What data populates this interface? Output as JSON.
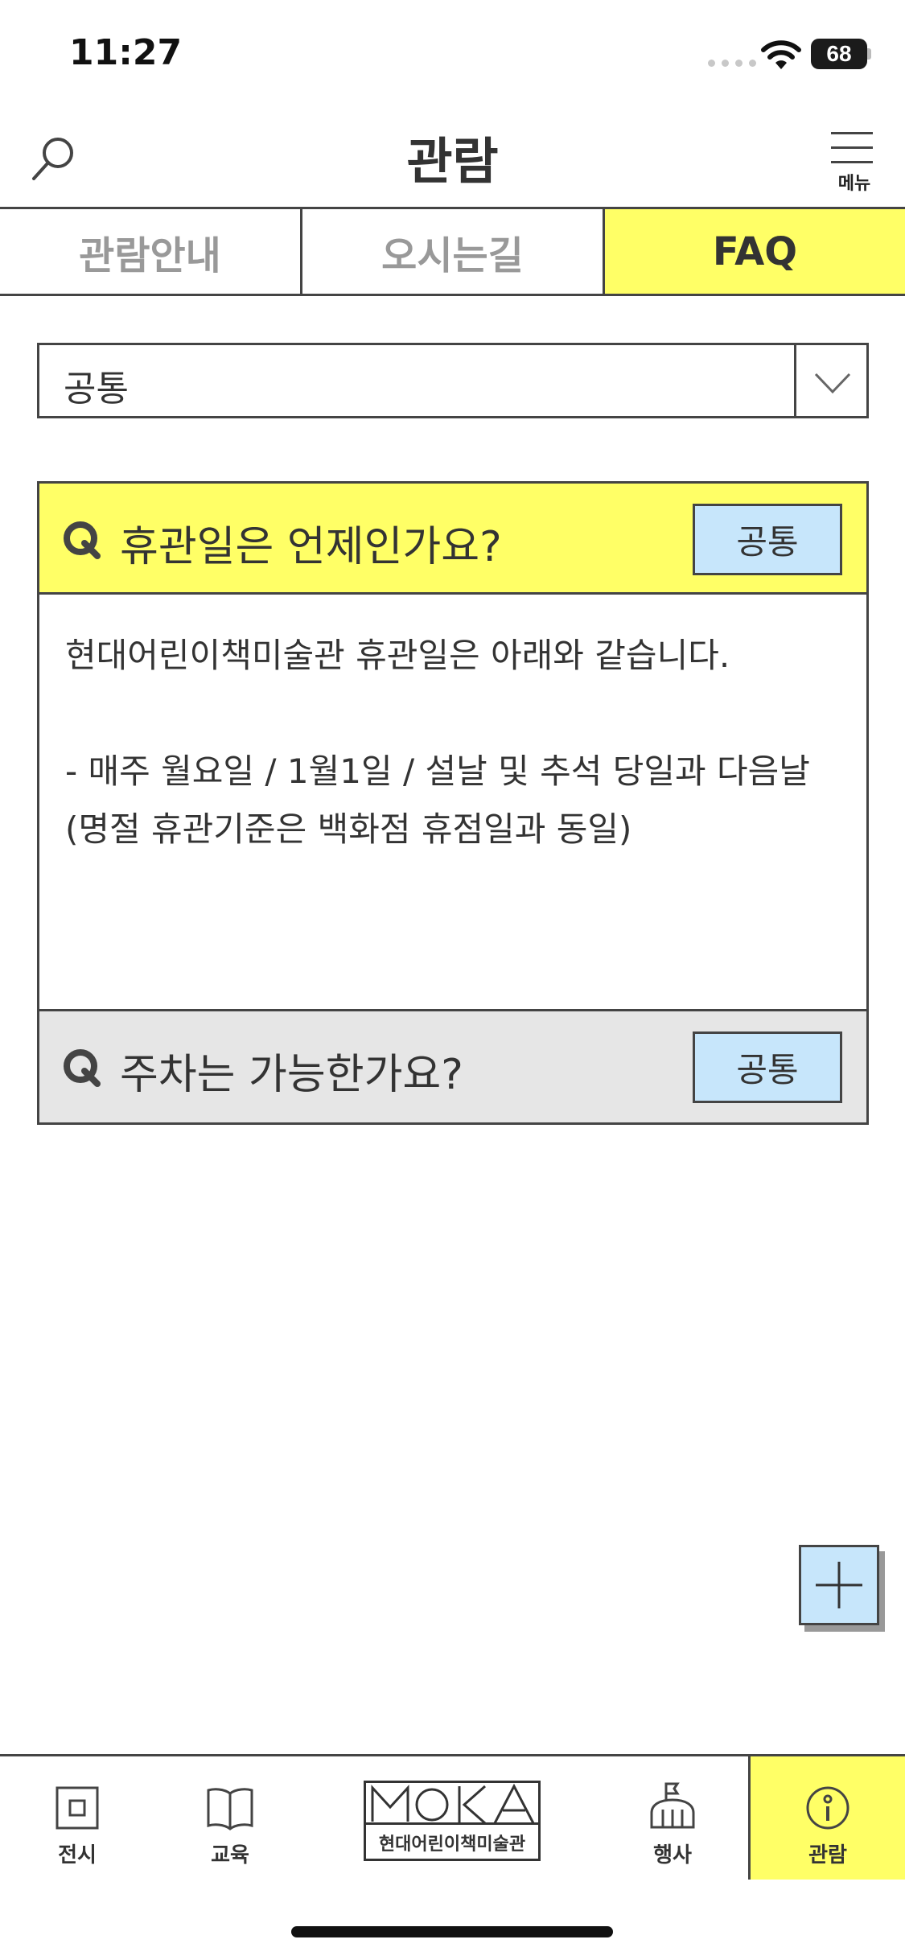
{
  "status_bar": {
    "time": "11:27",
    "battery": "68"
  },
  "header": {
    "title": "관람",
    "menu_label": "메뉴",
    "search_icon": "search-icon",
    "menu_icon": "hamburger-icon"
  },
  "tabs": [
    {
      "label": "관람안내",
      "active": false
    },
    {
      "label": "오시는길",
      "active": false
    },
    {
      "label": "FAQ",
      "active": true
    }
  ],
  "category_select": {
    "value": "공통",
    "icon": "chevron-down-icon"
  },
  "faq": [
    {
      "question": "휴관일은 언제인가요?",
      "badge": "공통",
      "expanded": true,
      "answer": "현대어린이책미술관 휴관일은 아래와 같습니다.\n\n- 매주 월요일 / 1월1일 / 설날 및 추석 당일과 다음날(명절 휴관기준은 백화점 휴점일과 동일)"
    },
    {
      "question": "주차는 가능한가요?",
      "badge": "공통",
      "expanded": false
    }
  ],
  "fab": {
    "icon": "plus-icon"
  },
  "bottom_nav": {
    "items": [
      {
        "label": "전시",
        "icon": "square-icon"
      },
      {
        "label": "교육",
        "icon": "book-icon"
      },
      {
        "label": "행사",
        "icon": "building-flag-icon"
      },
      {
        "label": "관람",
        "icon": "info-icon",
        "active": true
      }
    ],
    "logo": {
      "mark": "MOKA",
      "text": "현대어린이책미술관"
    }
  },
  "colors": {
    "accent_yellow": "#ffff66",
    "badge_blue": "#c7e6fb",
    "border": "#444444",
    "closed_row": "#e6e6e6"
  }
}
